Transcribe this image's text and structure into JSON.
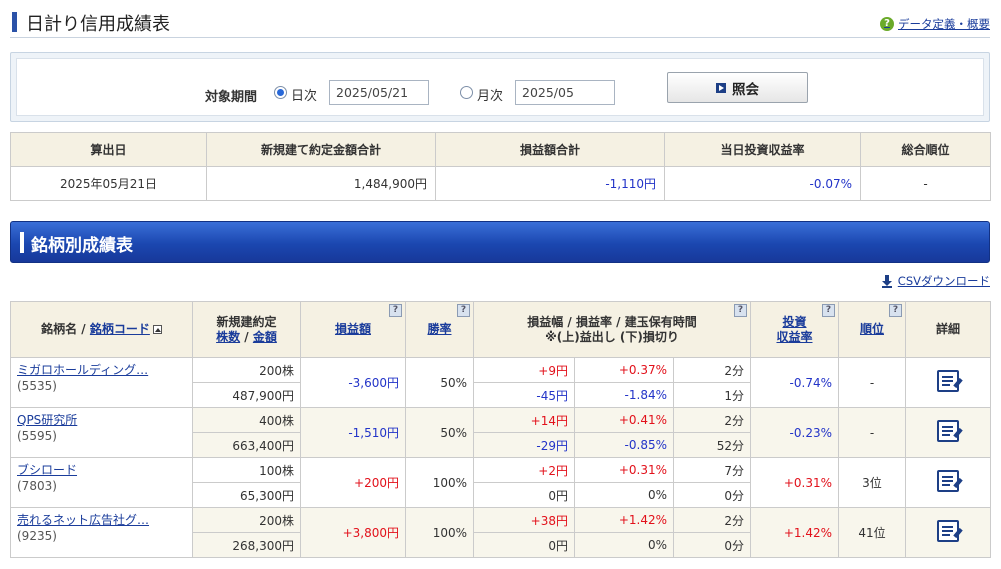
{
  "header": {
    "title": "日計り信用成績表",
    "help_link": "データ定義・概要"
  },
  "period": {
    "label": "対象期間",
    "daily_label": "日次",
    "daily_value": "2025/05/21",
    "monthly_label": "月次",
    "monthly_value": "2025/05",
    "selected": "daily",
    "query_button": "照会"
  },
  "summary": {
    "headers": [
      "算出日",
      "新規建て約定金額合計",
      "損益額合計",
      "当日投資収益率",
      "総合順位"
    ],
    "values": [
      "2025年05月21日",
      "1,484,900円",
      "-1,110円",
      "-0.07%",
      "-"
    ]
  },
  "section": {
    "title": "銘柄別成績表",
    "csv_link": "CSVダウンロード"
  },
  "detail": {
    "headers": {
      "name": "銘柄名",
      "slash": "/",
      "code": "銘柄コード",
      "new_contract": "新規建約定",
      "shares": "株数",
      "amount": "金額",
      "pl": "損益額",
      "win_rate": "勝率",
      "range_line1": "損益幅 / 損益率 / 建玉保有時間",
      "range_line2": "※(上)益出し (下)損切り",
      "yield_line1": "投資",
      "yield_line2": "収益率",
      "rank": "順位",
      "detail": "詳細"
    },
    "rows": [
      {
        "name": "ミガロホールディング…",
        "code": "(5535)",
        "shares": "200株",
        "amount": "487,900円",
        "pl": "-3,600円",
        "win_rate": "50%",
        "up": [
          "+9円",
          "+0.37%",
          "2分"
        ],
        "down": [
          "-45円",
          "-1.84%",
          "1分"
        ],
        "yield": "-0.74%",
        "rank": "-"
      },
      {
        "name": "QPS研究所",
        "code": "(5595)",
        "shares": "400株",
        "amount": "663,400円",
        "pl": "-1,510円",
        "win_rate": "50%",
        "up": [
          "+14円",
          "+0.41%",
          "2分"
        ],
        "down": [
          "-29円",
          "-0.85%",
          "52分"
        ],
        "yield": "-0.23%",
        "rank": "-"
      },
      {
        "name": "ブシロード",
        "code": "(7803)",
        "shares": "100株",
        "amount": "65,300円",
        "pl": "+200円",
        "win_rate": "100%",
        "up": [
          "+2円",
          "+0.31%",
          "7分"
        ],
        "down": [
          "0円",
          "0%",
          "0分"
        ],
        "yield": "+0.31%",
        "rank": "3位"
      },
      {
        "name": "売れるネット広告社グ…",
        "code": "(9235)",
        "shares": "200株",
        "amount": "268,300円",
        "pl": "+3,800円",
        "win_rate": "100%",
        "up": [
          "+38円",
          "+1.42%",
          "2分"
        ],
        "down": [
          "0円",
          "0%",
          "0分"
        ],
        "yield": "+1.42%",
        "rank": "41位"
      }
    ]
  }
}
